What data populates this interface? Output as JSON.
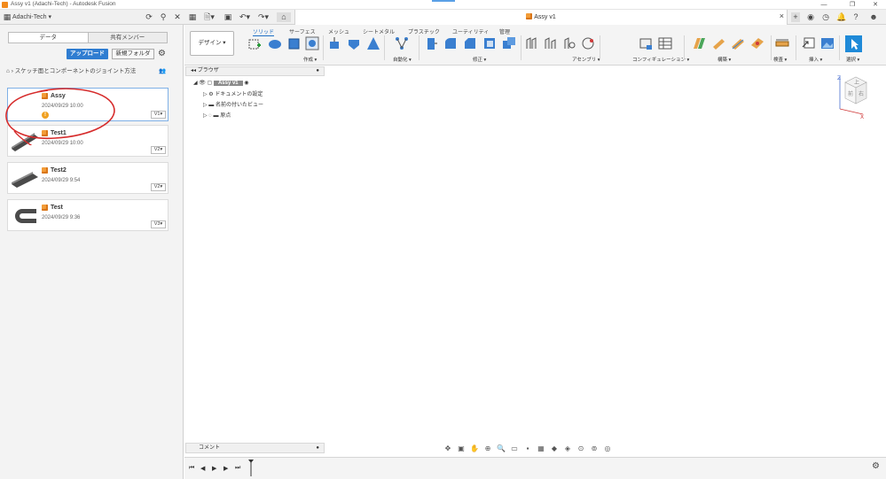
{
  "window": {
    "title": "Assy v1 (Adachi-Tech) - Autodesk Fusion",
    "min_glyph": "—",
    "max_glyph": "❐",
    "close_glyph": "✕"
  },
  "appbar": {
    "team": "Adachi-Tech",
    "doc_tab_title": "Assy v1"
  },
  "data_panel": {
    "tabs": [
      "データ",
      "共有メンバー"
    ],
    "upload_label": "アップロード",
    "new_folder_label": "新規フォルダ",
    "breadcrumb": "スケッチ面とコンポーネントのジョイント方法",
    "items": [
      {
        "name": "Assy",
        "date": "2024/09/29 10:00",
        "version": "V1▾",
        "warning": "!"
      },
      {
        "name": "Test1",
        "date": "2024/09/29 10:00",
        "version": "V2▾"
      },
      {
        "name": "Test2",
        "date": "2024/09/29 9:54",
        "version": "V2▾"
      },
      {
        "name": "Test",
        "date": "2024/09/29 9:36",
        "version": "V3▾"
      }
    ]
  },
  "ribbon": {
    "workspace": "デザイン ▾",
    "tabs": [
      "ソリッド",
      "サーフェス",
      "メッシュ",
      "シートメタル",
      "プラスチック",
      "ユーティリティ",
      "管理"
    ],
    "groups": [
      "作成 ▾",
      "自動化 ▾",
      "修正 ▾",
      "アセンブリ ▾",
      "コンフィギュレーション ▾",
      "構築 ▾",
      "検査 ▾",
      "挿入 ▾",
      "選択 ▾"
    ]
  },
  "browser": {
    "header": "ブラウザ",
    "root": "Assy v1",
    "nodes": [
      "ドキュメントの設定",
      "名前の付いたビュー",
      "原点"
    ]
  },
  "viewcube": {
    "top": "上",
    "front": "前",
    "right": "右",
    "axis_x": "X",
    "axis_z": "Z"
  },
  "comments": {
    "label": "コメント"
  },
  "colors": {
    "accent": "#2f7dd1",
    "annotation": "#d62b2b",
    "orange": "#f29c38"
  }
}
